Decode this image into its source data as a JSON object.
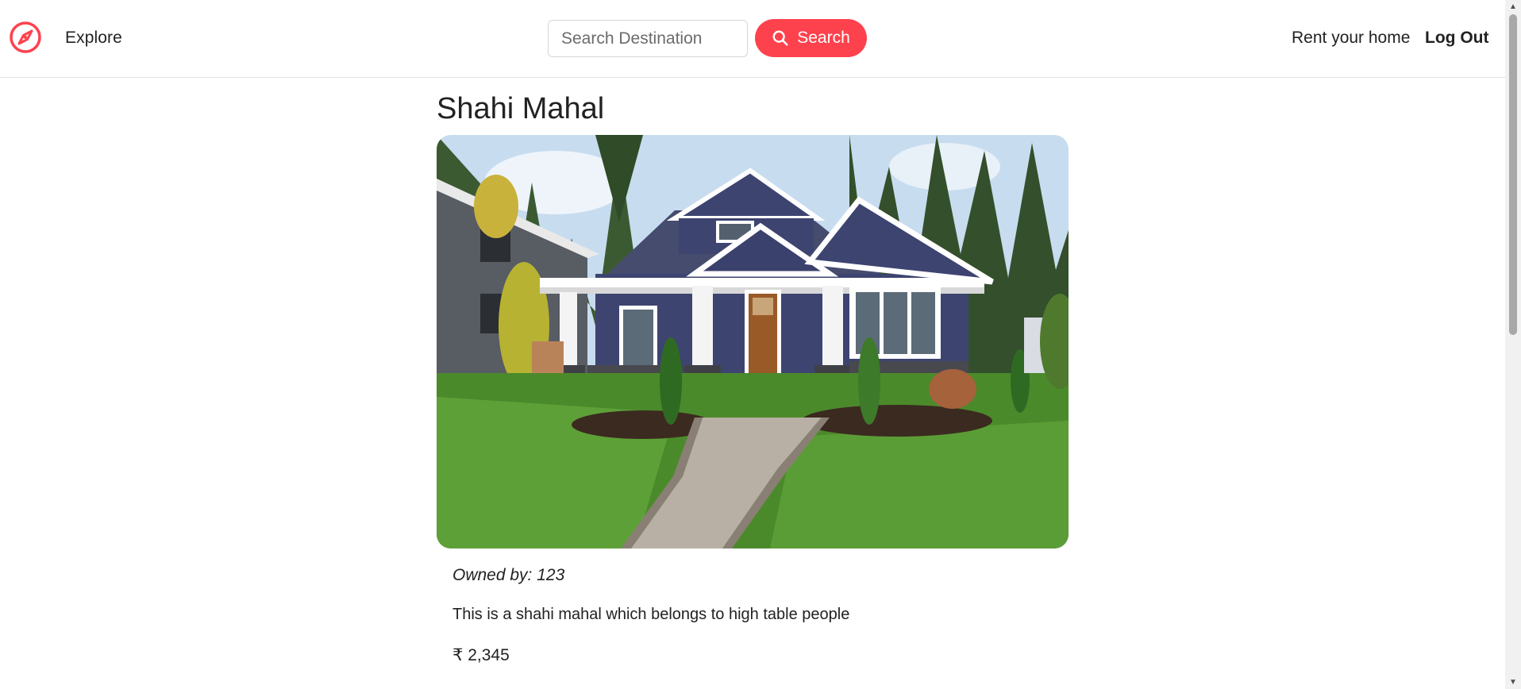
{
  "navbar": {
    "explore_label": "Explore",
    "search_placeholder": "Search Destination",
    "search_value": "",
    "search_button_label": "Search",
    "rent_label": "Rent your home",
    "logout_label": "Log Out",
    "logo_icon": "compass-icon",
    "search_icon": "search-icon"
  },
  "listing": {
    "title": "Shahi Mahal",
    "image_alt": "Blue craftsman house with white trim, stone pillars, green lawn and brick pathway",
    "owner": "Owned by: 123",
    "description": "This is a shahi mahal which belongs to high table people",
    "price": "₹ 2,345"
  },
  "colors": {
    "brand": "#fe424d",
    "text": "#222222",
    "border": "#e2e2e2"
  }
}
